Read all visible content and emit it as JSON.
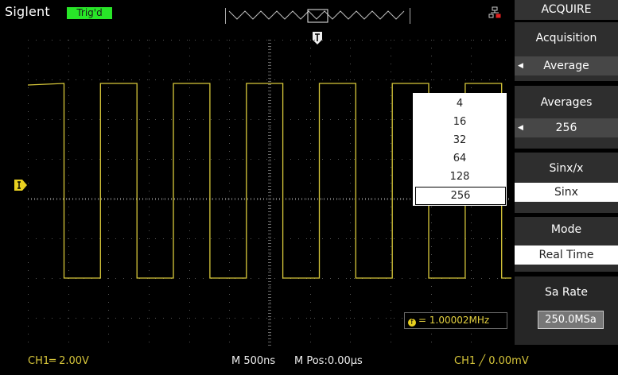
{
  "header": {
    "brand": "Siglent",
    "trigger_status": "Trig'd"
  },
  "colors": {
    "trigger_badge": "#28e628",
    "ch1_trace": "#d8c83a",
    "menu_bg": "#2e2e2e"
  },
  "icons": {
    "network": "network-disconnected-icon",
    "trigger_position": "trigger-position-T-icon",
    "ch1_ground": "ch1-marker-icon"
  },
  "averages_popup": {
    "options": [
      "4",
      "16",
      "32",
      "64",
      "128",
      "256"
    ],
    "selected": "256"
  },
  "frequency_readout": {
    "icon": "f",
    "text": "= 1.00002MHz"
  },
  "menu": {
    "title": "ACQUIRE",
    "acquisition": {
      "label": "Acquisition",
      "value": "Average"
    },
    "averages": {
      "label": "Averages",
      "value": "256"
    },
    "sinx": {
      "label": "Sinx/x",
      "value": "Sinx"
    },
    "mode": {
      "label": "Mode",
      "value": "Real Time"
    },
    "sa_rate": {
      "label": "Sa Rate",
      "value": "250.0MSa"
    }
  },
  "status_bar": {
    "ch1_scale": "CH1═ 2.00V",
    "timebase": "M 500ns",
    "mpos": "M Pos:0.00µs",
    "trigger": "CH1 ╱ 0.00mV"
  }
}
